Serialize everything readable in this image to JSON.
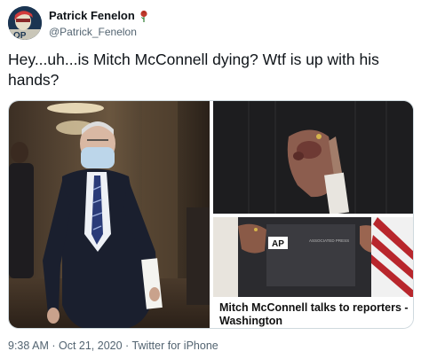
{
  "user": {
    "display_name": "Patrick Fenelon",
    "handle": "@Patrick_Fenelon",
    "badge_icon": "rose-icon"
  },
  "tweet": {
    "text": "Hey...uh...is Mitch McConnell dying? Wtf is up with his hands?"
  },
  "media": {
    "caption": "Mitch McConnell talks to reporters - Washington",
    "watermark": "ASSOCIATED PRESS"
  },
  "meta": {
    "time": "9:38 AM",
    "separator1": " · ",
    "date": "Oct 21, 2020",
    "separator2": " · ",
    "source": "Twitter for iPhone"
  },
  "colors": {
    "text": "#0f1419",
    "secondary": "#536471",
    "border": "#cfd9de",
    "rose": "#c0392b"
  }
}
